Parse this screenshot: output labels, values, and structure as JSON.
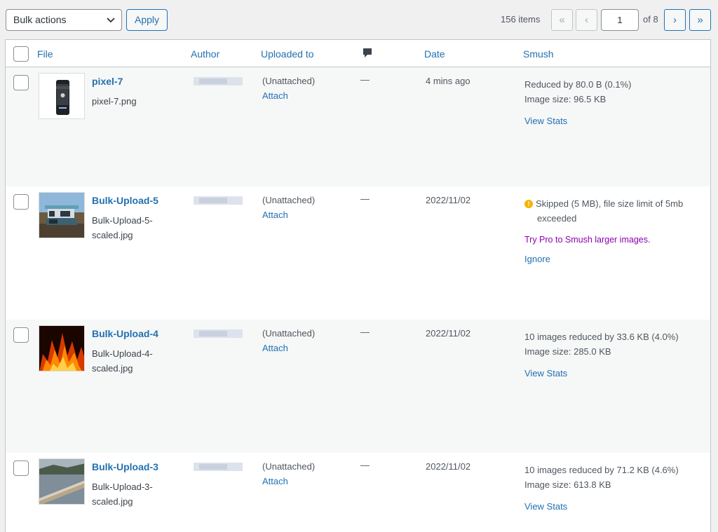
{
  "toolbar": {
    "bulk_actions_label": "Bulk actions",
    "apply_label": "Apply",
    "items_count": "156 items",
    "first_page": "«",
    "prev_page": "‹",
    "current_page": "1",
    "of_pages": "of 8",
    "next_page": "›",
    "last_page": "»"
  },
  "columns": {
    "file": "File",
    "author": "Author",
    "uploaded_to": "Uploaded to",
    "comments_icon": "comment-icon",
    "date": "Date",
    "smush": "Smush"
  },
  "rows": [
    {
      "title": "pixel-7",
      "filename": "pixel-7.png",
      "uploaded_to": "(Unattached)",
      "attach": "Attach",
      "comments": "—",
      "date": "4 mins ago",
      "smush_line1": "Reduced by 80.0 B (0.1%)",
      "smush_line2": "Image size: 96.5 KB",
      "smush_link": "View Stats"
    },
    {
      "title": "Bulk-Upload-5",
      "filename": "Bulk-Upload-5-scaled.jpg",
      "uploaded_to": "(Unattached)",
      "attach": "Attach",
      "comments": "—",
      "date": "2022/11/02",
      "smush_line1": "Skipped (5 MB), file size limit of 5mb",
      "smush_line2": "exceeded",
      "smush_pro": "Try Pro to Smush larger images.",
      "smush_link": "Ignore"
    },
    {
      "title": "Bulk-Upload-4",
      "filename": "Bulk-Upload-4-scaled.jpg",
      "uploaded_to": "(Unattached)",
      "attach": "Attach",
      "comments": "—",
      "date": "2022/11/02",
      "smush_line1": "10 images reduced by 33.6 KB (4.0%)",
      "smush_line2": "Image size: 285.0 KB",
      "smush_link": "View Stats"
    },
    {
      "title": "Bulk-Upload-3",
      "filename": "Bulk-Upload-3-scaled.jpg",
      "uploaded_to": "(Unattached)",
      "attach": "Attach",
      "comments": "—",
      "date": "2022/11/02",
      "smush_line1": "10 images reduced by 71.2 KB (4.6%)",
      "smush_line2": "Image size: 613.8 KB",
      "smush_link": "View Stats"
    }
  ],
  "colors": {
    "link": "#2271b1",
    "pro": "#8d00b1",
    "warning": "#f5b300"
  }
}
